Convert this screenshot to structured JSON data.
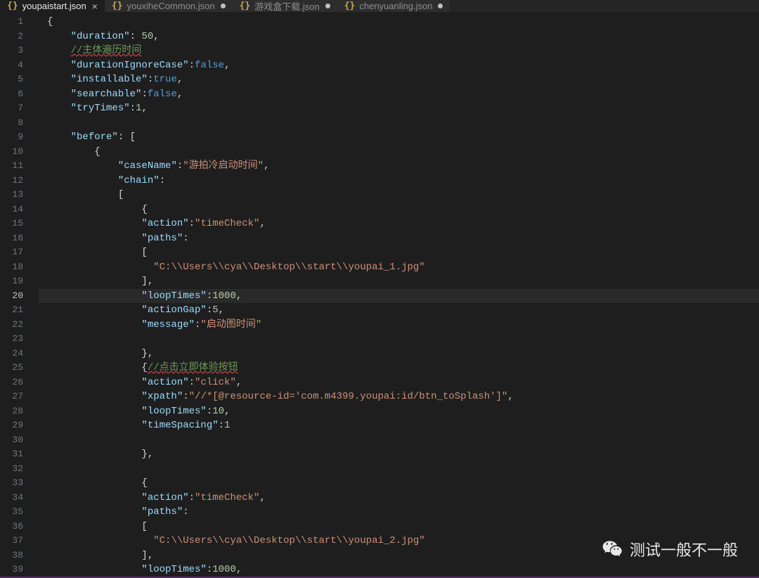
{
  "tabs": [
    {
      "name": "youpaistart.json",
      "active": true,
      "dirty": false
    },
    {
      "name": "youxiheCommon.json",
      "active": false,
      "dirty": true
    },
    {
      "name": "游戏盒下载.json",
      "active": false,
      "dirty": true
    },
    {
      "name": "chenyuanling.json",
      "active": false,
      "dirty": true
    }
  ],
  "currentLine": 20,
  "lineCount": 39,
  "braces_icon": "{}",
  "close_icon": "×",
  "code": {
    "l1": "{",
    "l2_k": "\"duration\"",
    "l2_v": "50",
    "l3_c": "//主体遍历时间",
    "l4_k": "\"durationIgnoreCase\"",
    "l4_v": "false",
    "l5_k": "\"installable\"",
    "l5_v": "true",
    "l6_k": "\"searchable\"",
    "l6_v": "false",
    "l7_k": "\"tryTimes\"",
    "l7_v": "1",
    "l9_k": "\"before\"",
    "l10": "{",
    "l11_k": "\"caseName\"",
    "l11_v": "\"游拍冷启动时间\"",
    "l12_k": "\"chain\"",
    "l15_k": "\"action\"",
    "l15_v": "\"timeCheck\"",
    "l16_k": "\"paths\"",
    "l18_v": "\"C:\\\\Users\\\\cya\\\\Desktop\\\\start\\\\youpai_1.jpg\"",
    "l20_k": "\"loopTimes\"",
    "l20_v": "1000",
    "l21_k": "\"actionGap\"",
    "l21_v": "5",
    "l22_k": "\"message\"",
    "l22_v": "\"启动图时间\"",
    "l25_c": "//点击立即体验按钮",
    "l26_k": "\"action\"",
    "l26_v": "\"click\"",
    "l27_k": "\"xpath\"",
    "l27_v": "\"//*[@resource-id='com.m4399.youpai:id/btn_toSplash']\"",
    "l28_k": "\"loopTimes\"",
    "l28_v": "10",
    "l29_k": "\"timeSpacing\"",
    "l29_v": "1",
    "l34_k": "\"action\"",
    "l34_v": "\"timeCheck\"",
    "l35_k": "\"paths\"",
    "l37_v": "\"C:\\\\Users\\\\cya\\\\Desktop\\\\start\\\\youpai_2.jpg\"",
    "l39_k": "\"loopTimes\"",
    "l39_v": "1000"
  },
  "watermark": "测试一般不一般"
}
